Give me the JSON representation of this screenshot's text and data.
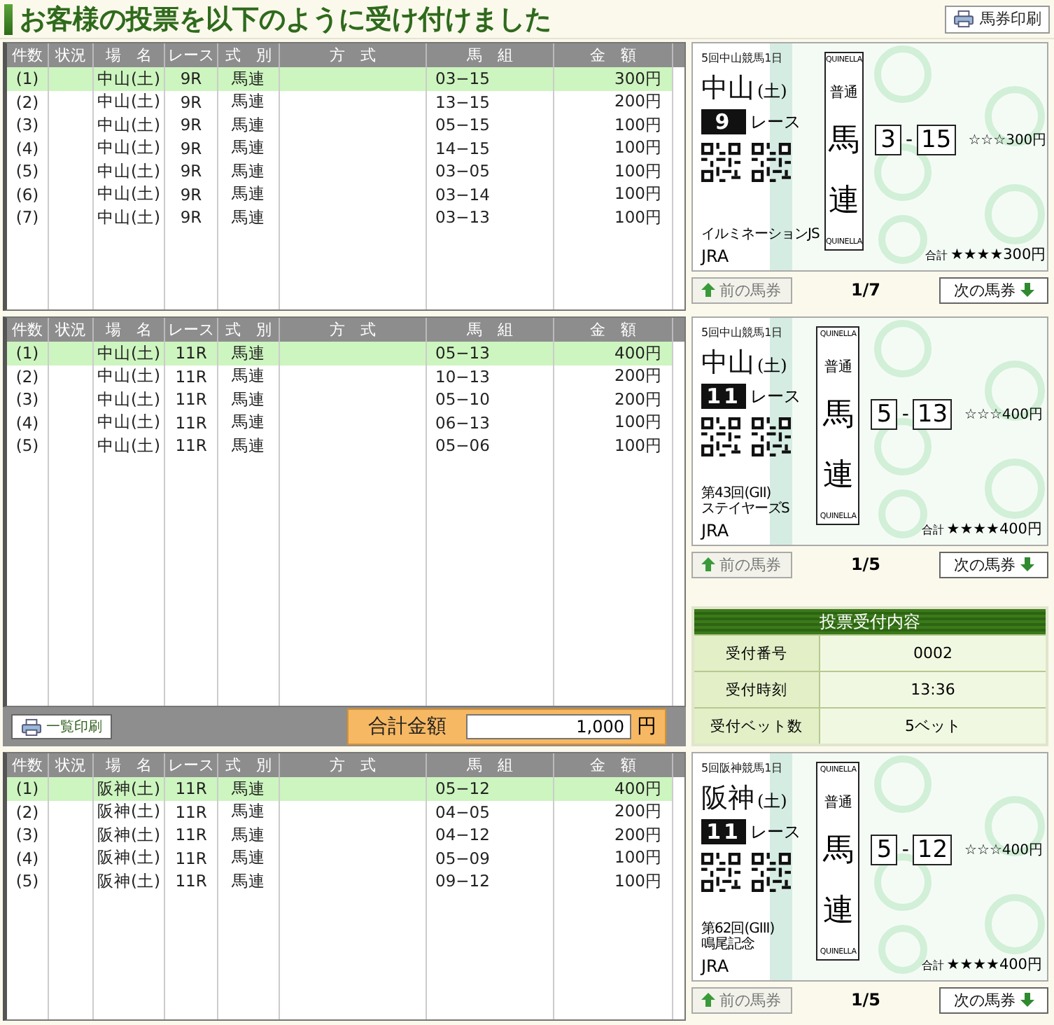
{
  "title": "お客様の投票を以下のように受け付けました",
  "print_button": "馬券印刷",
  "sections": [
    {
      "columns": [
        "件数",
        "状況",
        "場　名",
        "レース",
        "式　別",
        "方　式",
        "馬　組",
        "金　額"
      ],
      "rows": [
        {
          "number": "(1)",
          "venue": "中山(土)",
          "race": "9R",
          "type": "馬連",
          "combo": "03−15",
          "amount": "300円",
          "selected": true
        },
        {
          "number": "(2)",
          "venue": "中山(土)",
          "race": "9R",
          "type": "馬連",
          "combo": "13−15",
          "amount": "200円",
          "selected": false
        },
        {
          "number": "(3)",
          "venue": "中山(土)",
          "race": "9R",
          "type": "馬連",
          "combo": "05−15",
          "amount": "100円",
          "selected": false
        },
        {
          "number": "(4)",
          "venue": "中山(土)",
          "race": "9R",
          "type": "馬連",
          "combo": "14−15",
          "amount": "100円",
          "selected": false
        },
        {
          "number": "(5)",
          "venue": "中山(土)",
          "race": "9R",
          "type": "馬連",
          "combo": "03−05",
          "amount": "100円",
          "selected": false
        },
        {
          "number": "(6)",
          "venue": "中山(土)",
          "race": "9R",
          "type": "馬連",
          "combo": "03−14",
          "amount": "100円",
          "selected": false
        },
        {
          "number": "(7)",
          "venue": "中山(土)",
          "race": "9R",
          "type": "馬連",
          "combo": "03−13",
          "amount": "100円",
          "selected": false
        }
      ],
      "ticket": {
        "meeting": "5回中山競馬1日",
        "venue": "中山",
        "day": "(土)",
        "race_number": "9",
        "race_label": "レース",
        "race_name": [
          "イルミネーションJS"
        ],
        "operator": "JRA",
        "bet_label_top": "QUINELLA",
        "bet_kind": "普通",
        "bet_type": [
          "馬",
          "連"
        ],
        "bet_label_bottom": "QUINELLA",
        "combo": [
          "3",
          "15"
        ],
        "separator": "-",
        "per_bet": "☆☆☆300円",
        "total_label": "合計",
        "total": "★★★★300円"
      },
      "nav": {
        "prev": "前の馬券",
        "page": "1/7",
        "next": "次の馬券"
      }
    },
    {
      "columns": [
        "件数",
        "状況",
        "場　名",
        "レース",
        "式　別",
        "方　式",
        "馬　組",
        "金　額"
      ],
      "rows": [
        {
          "number": "(1)",
          "venue": "中山(土)",
          "race": "11R",
          "type": "馬連",
          "combo": "05−13",
          "amount": "400円",
          "selected": true
        },
        {
          "number": "(2)",
          "venue": "中山(土)",
          "race": "11R",
          "type": "馬連",
          "combo": "10−13",
          "amount": "200円",
          "selected": false
        },
        {
          "number": "(3)",
          "venue": "中山(土)",
          "race": "11R",
          "type": "馬連",
          "combo": "05−10",
          "amount": "200円",
          "selected": false
        },
        {
          "number": "(4)",
          "venue": "中山(土)",
          "race": "11R",
          "type": "馬連",
          "combo": "06−13",
          "amount": "100円",
          "selected": false
        },
        {
          "number": "(5)",
          "venue": "中山(土)",
          "race": "11R",
          "type": "馬連",
          "combo": "05−06",
          "amount": "100円",
          "selected": false
        }
      ],
      "ticket": {
        "meeting": "5回中山競馬1日",
        "venue": "中山",
        "day": "(土)",
        "race_number": "11",
        "race_label": "レース",
        "race_name": [
          "第43回(GII)",
          "ステイヤーズS"
        ],
        "operator": "JRA",
        "bet_label_top": "QUINELLA",
        "bet_kind": "普通",
        "bet_type": [
          "馬",
          "連"
        ],
        "bet_label_bottom": "QUINELLA",
        "combo": [
          "5",
          "13"
        ],
        "separator": "-",
        "per_bet": "☆☆☆400円",
        "total_label": "合計",
        "total": "★★★★400円"
      },
      "nav": {
        "prev": "前の馬券",
        "page": "1/5",
        "next": "次の馬券"
      },
      "footer": {
        "list_print": "一覧印刷",
        "total_label": "合計金額",
        "total_value": "1,000",
        "unit": "円"
      },
      "summary": {
        "title": "投票受付内容",
        "rows": [
          {
            "label": "受付番号",
            "value": "0002"
          },
          {
            "label": "受付時刻",
            "value": "13:36"
          },
          {
            "label": "受付ベット数",
            "value": "5ベット"
          }
        ]
      }
    },
    {
      "columns": [
        "件数",
        "状況",
        "場　名",
        "レース",
        "式　別",
        "方　式",
        "馬　組",
        "金　額"
      ],
      "rows": [
        {
          "number": "(1)",
          "venue": "阪神(土)",
          "race": "11R",
          "type": "馬連",
          "combo": "05−12",
          "amount": "400円",
          "selected": true
        },
        {
          "number": "(2)",
          "venue": "阪神(土)",
          "race": "11R",
          "type": "馬連",
          "combo": "04−05",
          "amount": "200円",
          "selected": false
        },
        {
          "number": "(3)",
          "venue": "阪神(土)",
          "race": "11R",
          "type": "馬連",
          "combo": "04−12",
          "amount": "200円",
          "selected": false
        },
        {
          "number": "(4)",
          "venue": "阪神(土)",
          "race": "11R",
          "type": "馬連",
          "combo": "05−09",
          "amount": "100円",
          "selected": false
        },
        {
          "number": "(5)",
          "venue": "阪神(土)",
          "race": "11R",
          "type": "馬連",
          "combo": "09−12",
          "amount": "100円",
          "selected": false
        }
      ],
      "ticket": {
        "meeting": "5回阪神競馬1日",
        "venue": "阪神",
        "day": "(土)",
        "race_number": "11",
        "race_label": "レース",
        "race_name": [
          "第62回(GIII)",
          "鳴尾記念"
        ],
        "operator": "JRA",
        "bet_label_top": "QUINELLA",
        "bet_kind": "普通",
        "bet_type": [
          "馬",
          "連"
        ],
        "bet_label_bottom": "QUINELLA",
        "combo": [
          "5",
          "12"
        ],
        "separator": "-",
        "per_bet": "☆☆☆400円",
        "total_label": "合計",
        "total": "★★★★400円"
      },
      "nav": {
        "prev": "前の馬券",
        "page": "1/5",
        "next": "次の馬券"
      }
    }
  ]
}
